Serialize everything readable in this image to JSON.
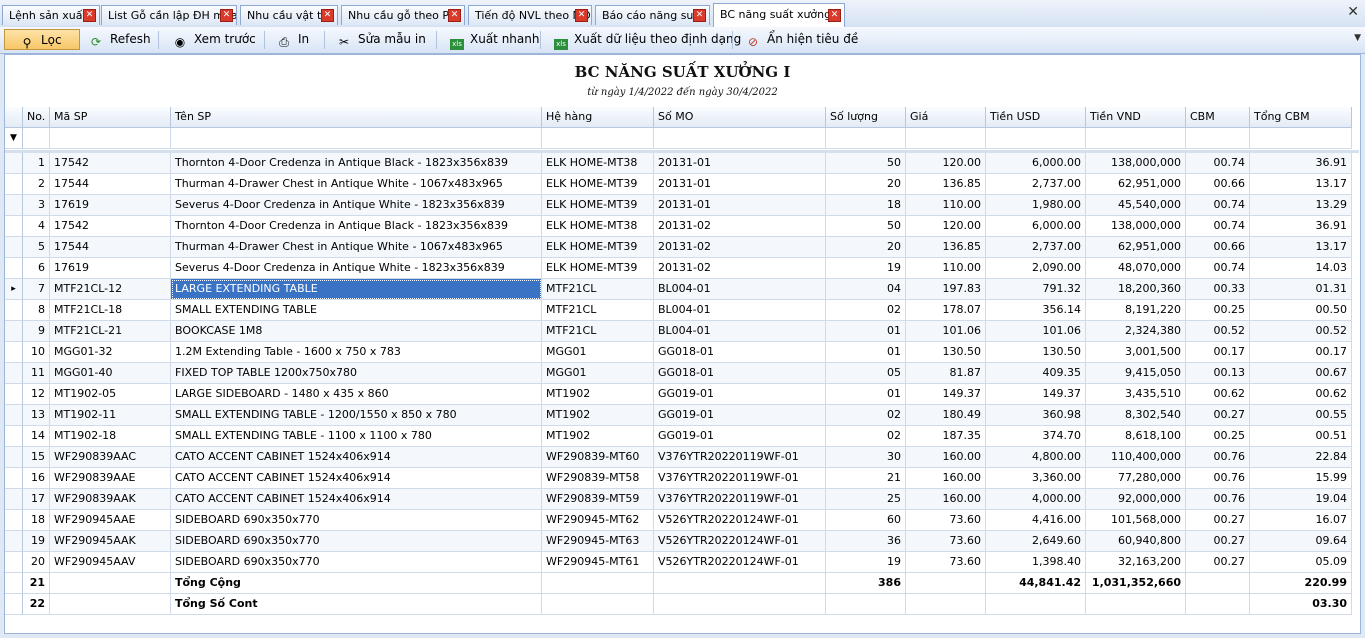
{
  "tabs": [
    {
      "label": "Lệnh sản xuất",
      "active": false
    },
    {
      "label": "List Gỗ cần lập ĐH mua",
      "active": false
    },
    {
      "label": "Nhu cầu vật tư",
      "active": false
    },
    {
      "label": "Nhu cầu gỗ theo PO",
      "active": false
    },
    {
      "label": "Tiến độ NVL theo MO",
      "active": false
    },
    {
      "label": "Báo cáo năng suất",
      "active": false
    },
    {
      "label": "BC năng suất xưởng I",
      "active": true
    }
  ],
  "tab_close_glyph": "✕",
  "toolbar": {
    "filter": "Lọc",
    "refresh": "Refesh",
    "preview": "Xem trước",
    "print": "In",
    "edit_template": "Sửa mẫu in",
    "quick_export": "Xuất nhanh",
    "export_format": "Xuất dữ liệu theo định dạng",
    "toggle_title": "Ẩn hiện tiêu đề"
  },
  "report": {
    "title": "BC NĂNG SUẤT XƯỞNG I",
    "subtitle": "từ ngày 1/4/2022  đến ngày 30/4/2022"
  },
  "grid": {
    "columns": [
      "No.",
      "Mã SP",
      "Tên SP",
      "Hệ hàng",
      "Số MO",
      "Số lượng",
      "Giá",
      "Tiền USD",
      "Tiền VND",
      "CBM",
      "Tổng CBM"
    ],
    "rows": [
      [
        "1",
        "17542",
        "Thornton 4-Door Credenza in Antique Black - 1823x356x839",
        "ELK HOME-MT38",
        "20131-01",
        "50",
        "120.00",
        "6,000.00",
        "138,000,000",
        "00.74",
        "36.91"
      ],
      [
        "2",
        "17544",
        "Thurman 4-Drawer Chest in Antique White - 1067x483x965",
        "ELK HOME-MT39",
        "20131-01",
        "20",
        "136.85",
        "2,737.00",
        "62,951,000",
        "00.66",
        "13.17"
      ],
      [
        "3",
        "17619",
        "Severus 4-Door Credenza in Antique White - 1823x356x839",
        "ELK HOME-MT39",
        "20131-01",
        "18",
        "110.00",
        "1,980.00",
        "45,540,000",
        "00.74",
        "13.29"
      ],
      [
        "4",
        "17542",
        "Thornton 4-Door Credenza in Antique Black - 1823x356x839",
        "ELK HOME-MT38",
        "20131-02",
        "50",
        "120.00",
        "6,000.00",
        "138,000,000",
        "00.74",
        "36.91"
      ],
      [
        "5",
        "17544",
        "Thurman 4-Drawer Chest in Antique White - 1067x483x965",
        "ELK HOME-MT39",
        "20131-02",
        "20",
        "136.85",
        "2,737.00",
        "62,951,000",
        "00.66",
        "13.17"
      ],
      [
        "6",
        "17619",
        "Severus 4-Door Credenza in Antique White - 1823x356x839",
        "ELK HOME-MT39",
        "20131-02",
        "19",
        "110.00",
        "2,090.00",
        "48,070,000",
        "00.74",
        "14.03"
      ],
      [
        "7",
        "MTF21CL-12",
        "LARGE EXTENDING TABLE",
        "MTF21CL",
        "BL004-01",
        "04",
        "197.83",
        "791.32",
        "18,200,360",
        "00.33",
        "01.31"
      ],
      [
        "8",
        "MTF21CL-18",
        "SMALL EXTENDING TABLE",
        "MTF21CL",
        "BL004-01",
        "02",
        "178.07",
        "356.14",
        "8,191,220",
        "00.25",
        "00.50"
      ],
      [
        "9",
        "MTF21CL-21",
        "BOOKCASE 1M8",
        "MTF21CL",
        "BL004-01",
        "01",
        "101.06",
        "101.06",
        "2,324,380",
        "00.52",
        "00.52"
      ],
      [
        "10",
        "MGG01-32",
        "1.2M Extending Table - 1600 x 750 x 783",
        "MGG01",
        "GG018-01",
        "01",
        "130.50",
        "130.50",
        "3,001,500",
        "00.17",
        "00.17"
      ],
      [
        "11",
        "MGG01-40",
        "FIXED TOP TABLE 1200x750x780",
        "MGG01",
        "GG018-01",
        "05",
        "81.87",
        "409.35",
        "9,415,050",
        "00.13",
        "00.67"
      ],
      [
        "12",
        "MT1902-05",
        "LARGE SIDEBOARD - 1480 x 435 x 860",
        "MT1902",
        "GG019-01",
        "01",
        "149.37",
        "149.37",
        "3,435,510",
        "00.62",
        "00.62"
      ],
      [
        "13",
        "MT1902-11",
        "SMALL EXTENDING TABLE - 1200/1550 x 850 x 780",
        "MT1902",
        "GG019-01",
        "02",
        "180.49",
        "360.98",
        "8,302,540",
        "00.27",
        "00.55"
      ],
      [
        "14",
        "MT1902-18",
        "SMALL EXTENDING TABLE - 1100 x 1100 x 780",
        "MT1902",
        "GG019-01",
        "02",
        "187.35",
        "374.70",
        "8,618,100",
        "00.25",
        "00.51"
      ],
      [
        "15",
        "WF290839AAC",
        "CATO ACCENT CABINET 1524x406x914",
        "WF290839-MT60",
        "V376YTR20220119WF-01",
        "30",
        "160.00",
        "4,800.00",
        "110,400,000",
        "00.76",
        "22.84"
      ],
      [
        "16",
        "WF290839AAE",
        "CATO ACCENT CABINET 1524x406x914",
        "WF290839-MT58",
        "V376YTR20220119WF-01",
        "21",
        "160.00",
        "3,360.00",
        "77,280,000",
        "00.76",
        "15.99"
      ],
      [
        "17",
        "WF290839AAK",
        "CATO ACCENT CABINET 1524x406x914",
        "WF290839-MT59",
        "V376YTR20220119WF-01",
        "25",
        "160.00",
        "4,000.00",
        "92,000,000",
        "00.76",
        "19.04"
      ],
      [
        "18",
        "WF290945AAE",
        "SIDEBOARD 690x350x770",
        "WF290945-MT62",
        "V526YTR20220124WF-01",
        "60",
        "73.60",
        "4,416.00",
        "101,568,000",
        "00.27",
        "16.07"
      ],
      [
        "19",
        "WF290945AAK",
        "SIDEBOARD 690x350x770",
        "WF290945-MT63",
        "V526YTR20220124WF-01",
        "36",
        "73.60",
        "2,649.60",
        "60,940,800",
        "00.27",
        "09.64"
      ],
      [
        "20",
        "WF290945AAV",
        "SIDEBOARD 690x350x770",
        "WF290945-MT61",
        "V526YTR20220124WF-01",
        "19",
        "73.60",
        "1,398.40",
        "32,163,200",
        "00.27",
        "05.09"
      ]
    ],
    "totals": [
      [
        "21",
        "",
        "Tổng Cộng",
        "",
        "",
        "386",
        "",
        "44,841.42",
        "1,031,352,660",
        "",
        "220.99"
      ],
      [
        "22",
        "",
        "Tổng Số Cont",
        "",
        "",
        "",
        "",
        "",
        "",
        "",
        "03.30"
      ]
    ],
    "selected_row": 7,
    "row_indicator": "▸",
    "filter_icon": "funnel-icon"
  }
}
